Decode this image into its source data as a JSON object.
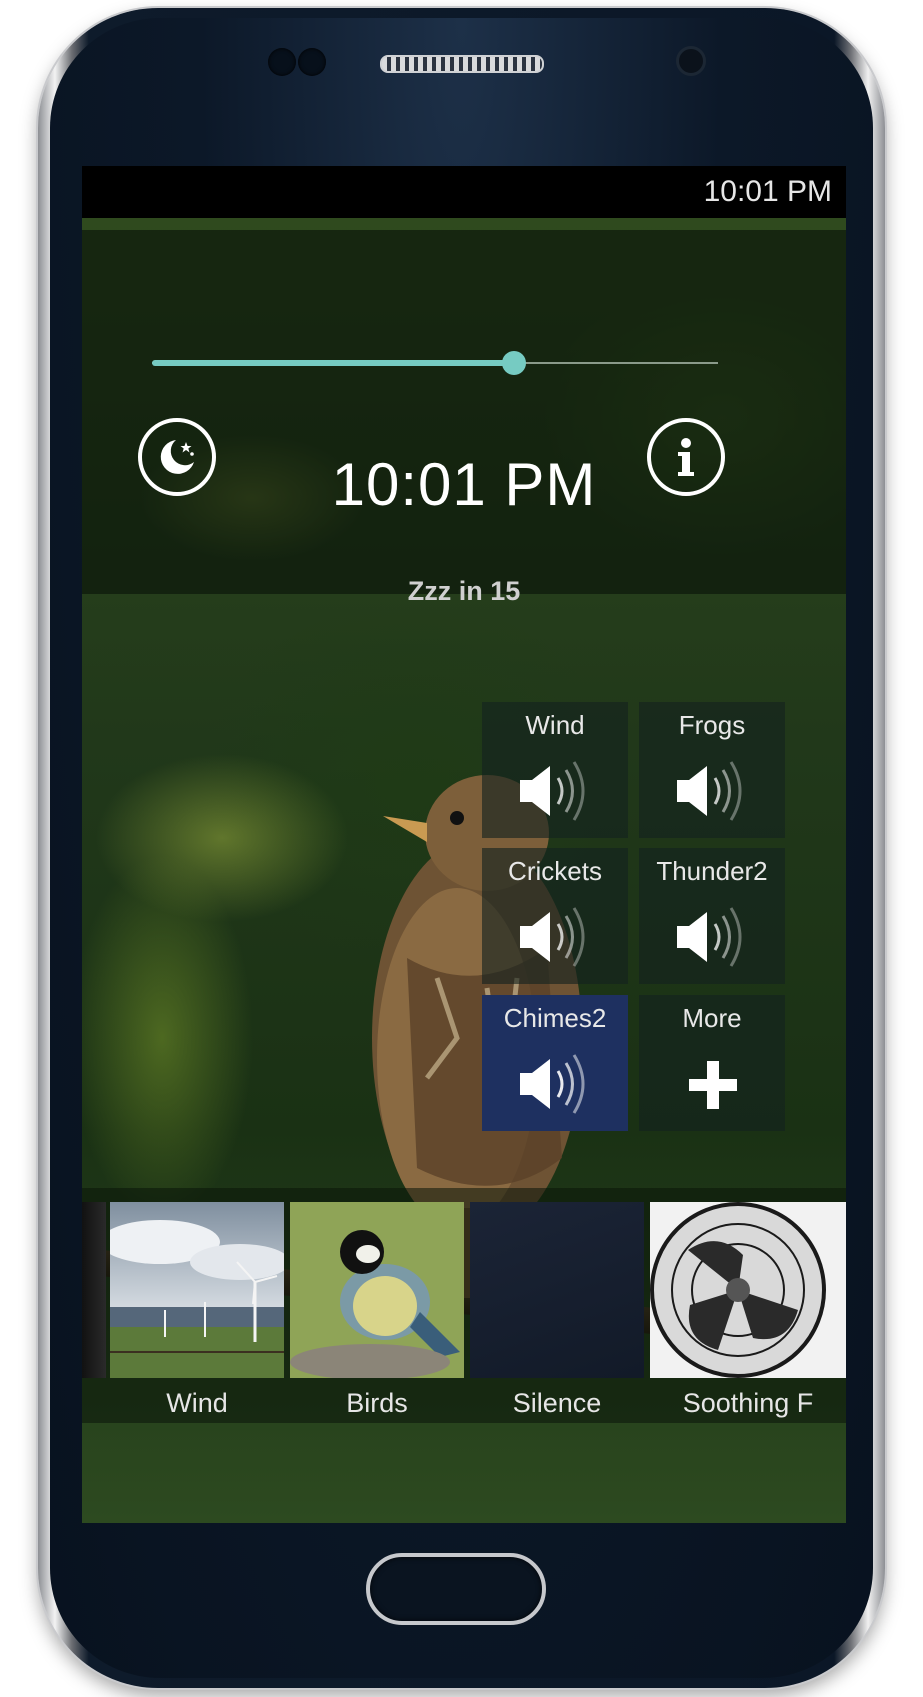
{
  "status_bar": {
    "time": "10:01 PM"
  },
  "player": {
    "volume_level": 0.64,
    "clock": "10:01 PM",
    "sleep_timer_text": "Zzz in 15"
  },
  "sound_tiles": [
    {
      "label": "Wind",
      "icon": "speaker-icon",
      "active": false
    },
    {
      "label": "Frogs",
      "icon": "speaker-icon",
      "active": false
    },
    {
      "label": "Crickets",
      "icon": "speaker-icon",
      "active": false
    },
    {
      "label": "Thunder2",
      "icon": "speaker-icon",
      "active": false
    },
    {
      "label": "Chimes2",
      "icon": "speaker-icon",
      "active": true
    },
    {
      "label": "More",
      "icon": "plus-icon",
      "active": false
    }
  ],
  "scenes": [
    {
      "label": "Wind"
    },
    {
      "label": "Birds"
    },
    {
      "label": "Silence"
    },
    {
      "label": "Soothing F"
    }
  ],
  "colors": {
    "accent": "#76cbc2",
    "active_tile": "#1e3060"
  }
}
